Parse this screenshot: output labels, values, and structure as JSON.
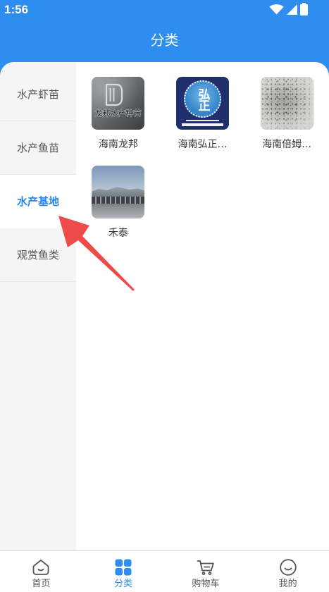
{
  "colors": {
    "accent": "#2e8ef0",
    "accent_text": "#2a86e2",
    "annotation_arrow": "#ef4a4a"
  },
  "status_bar": {
    "time": "1:56",
    "icons": [
      "wifi-icon",
      "signal-icon",
      "battery-icon"
    ]
  },
  "header": {
    "title": "分类"
  },
  "sidebar": {
    "items": [
      {
        "label": "水产虾苗",
        "selected": false
      },
      {
        "label": "水产鱼苗",
        "selected": false
      },
      {
        "label": "水产基地",
        "selected": true
      },
      {
        "label": "观赏鱼类",
        "selected": false
      }
    ]
  },
  "grid": {
    "items": [
      {
        "label": "海南龙邦",
        "logo_text": "龙邦水产种苗"
      },
      {
        "label": "海南弘正…",
        "logo_text": "弘正"
      },
      {
        "label": "海南倍姆…"
      },
      {
        "label": "禾泰"
      }
    ]
  },
  "tabbar": {
    "tabs": [
      {
        "label": "首页",
        "icon": "home-icon",
        "active": false
      },
      {
        "label": "分类",
        "icon": "category-grid-icon",
        "active": true
      },
      {
        "label": "购物车",
        "icon": "shopping-cart-icon",
        "active": false
      },
      {
        "label": "我的",
        "icon": "profile-smile-icon",
        "active": false
      }
    ]
  }
}
